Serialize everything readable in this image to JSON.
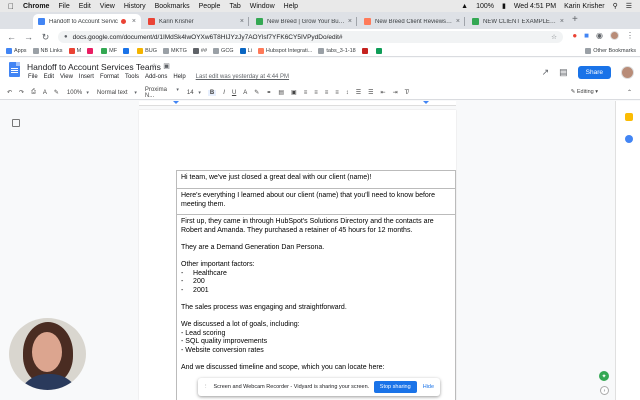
{
  "macbar": {
    "app": "Chrome",
    "menus": [
      "File",
      "Edit",
      "View",
      "History",
      "Bookmarks",
      "People",
      "Tab",
      "Window",
      "Help"
    ],
    "battery": "100%",
    "clock": "Wed 4:51 PM",
    "user": "Karin Krisher"
  },
  "tabs": [
    {
      "title": "Handoff to Account Servic",
      "color": "#4285f4"
    },
    {
      "title": "Karin Krisher",
      "color": "#ea4335"
    },
    {
      "title": "New Breed | Grow Your Busine",
      "color": "#34a853"
    },
    {
      "title": "New Breed Client Reviews | H",
      "color": "#ff7a59"
    },
    {
      "title": "NEW CLIENT EXAMPLE - Goo",
      "color": "#34a853"
    }
  ],
  "url": "docs.google.com/document/d/1IMdSk4lwOYXw6T8HIJYzJy7AOYlsf7YFK6CY5IVPydDo/edit#",
  "bookmarks": [
    "Apps",
    "NB Links",
    "M",
    "MF",
    "BUG",
    "MKTG",
    "##",
    "GCG",
    "Li",
    "Hubspot Integrati...",
    "tabs_3-1-18"
  ],
  "bookmarks_other": "Other Bookmarks",
  "doc": {
    "title": "Handoff to Account Services Teams",
    "menus": [
      "File",
      "Edit",
      "View",
      "Insert",
      "Format",
      "Tools",
      "Add-ons",
      "Help"
    ],
    "last_edit": "Last edit was yesterday at 4:44 PM",
    "share": "Share"
  },
  "toolbar": {
    "zoom": "100%",
    "style": "Normal text",
    "font": "Proxima N...",
    "size": "14",
    "editing": "Editing"
  },
  "content": {
    "row1": "Hi team, we've just closed a great deal with our client (name)!",
    "row2": "Here's everything I learned about our client (name) that you'll need to know before meeting them.",
    "p1": "First up, they came in through HubSpot's Solutions Directory and the contacts are Robert and Amanda. They purchased a retainer of 45 hours for 12 months.",
    "p2": "They are a Demand Generation Dan Persona.",
    "p3": "Other important factors:",
    "factors": [
      "-     Healthcare",
      "-     200",
      "-     2001"
    ],
    "p4": "The sales process was engaging and straightforward.",
    "p5": "We discussed a lot of goals, including:",
    "goals": [
      "- Lead scoring",
      "- SQL quality improvements",
      "- Website conversion rates"
    ],
    "p6": "And we discussed timeline and scope, which you can locate here:"
  },
  "sharebar": {
    "text": "Screen and Webcam Recorder - Vidyard is sharing your screen.",
    "stop": "Stop sharing",
    "hide": "Hide"
  }
}
